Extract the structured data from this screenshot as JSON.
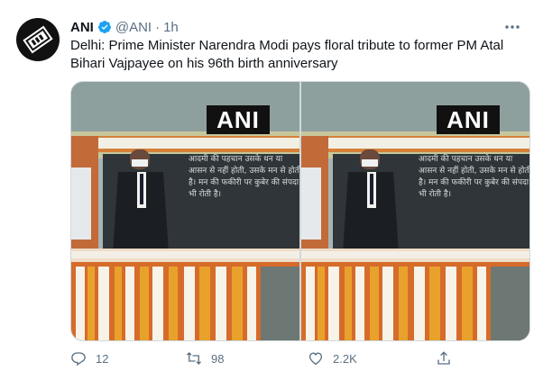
{
  "tweet": {
    "author_name": "ANI",
    "handle": "@ANI",
    "separator": "·",
    "time": "1h",
    "text": "Delhi: Prime Minister Narendra Modi pays floral tribute to former PM Atal Bihari Vajpayee on his 96th birth anniversary",
    "watermark": "ANI",
    "wall_inscription": "आदमी की पहचान उसके धन या आसन से नहीं होती, उसके मन से होती है। मन की फकीरी पर कुबेर की संपदा भी रोती है।",
    "reply_count": "12",
    "retweet_count": "98",
    "like_count": "2.2K",
    "icons": {
      "avatar": "ani-logo",
      "verified": "verified-badge-icon",
      "more": "more-icon",
      "reply": "reply-icon",
      "retweet": "retweet-icon",
      "like": "heart-icon",
      "share": "share-icon"
    },
    "colors": {
      "verified": "#1da1f2",
      "muted": "#5b7083",
      "text": "#0f1419"
    }
  }
}
